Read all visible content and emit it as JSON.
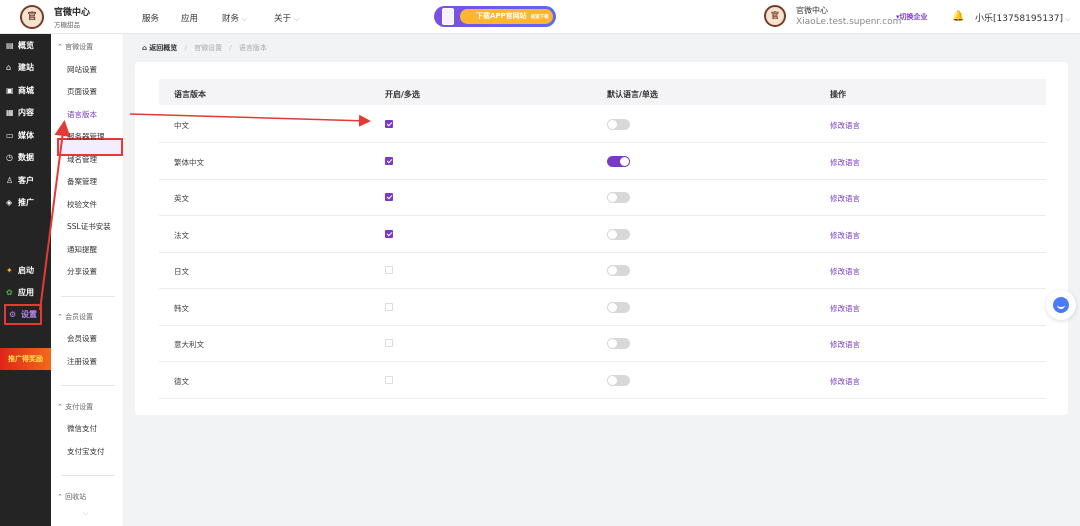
{
  "brand": {
    "logo_text": "官",
    "title": "官微中心",
    "subtitle": "方糖甜品"
  },
  "topnav": {
    "items": [
      "服务",
      "应用",
      "财务",
      "关于"
    ]
  },
  "banner": {
    "text": "下载APP官网站",
    "small": "极速下载"
  },
  "org": {
    "logo_text": "官",
    "name": "官微中心",
    "domain": "XiaoLe.test.supenr.com",
    "switch_label": "切换企业"
  },
  "user": {
    "name": "小乐[13758195137]"
  },
  "sidebar": {
    "items": [
      {
        "icon": "overview-icon",
        "glyph": "▤",
        "label": "概览"
      },
      {
        "icon": "build-icon",
        "glyph": "⌂",
        "label": "建站"
      },
      {
        "icon": "shop-icon",
        "glyph": "▣",
        "label": "商城"
      },
      {
        "icon": "content-icon",
        "glyph": "▦",
        "label": "内容"
      },
      {
        "icon": "media-icon",
        "glyph": "▭",
        "label": "媒体"
      },
      {
        "icon": "data-icon",
        "glyph": "◷",
        "label": "数据"
      },
      {
        "icon": "customer-icon",
        "glyph": "♙",
        "label": "客户"
      },
      {
        "icon": "promote-icon",
        "glyph": "◈",
        "label": "推广"
      }
    ],
    "bottom": [
      {
        "icon": "launch-icon",
        "glyph": "✦",
        "label": "启动"
      },
      {
        "icon": "apps-icon",
        "glyph": "✿",
        "label": "应用"
      },
      {
        "icon": "settings-icon",
        "glyph": "⚙",
        "label": "设置"
      }
    ],
    "promo": "推广得奖励"
  },
  "subnav": {
    "group1": {
      "title": "官微设置",
      "items": [
        "网站设置",
        "页面设置",
        "语言版本",
        "服务器管理",
        "域名管理",
        "备案管理",
        "校验文件",
        "SSL证书安装",
        "通知提醒",
        "分享设置"
      ]
    },
    "group2": {
      "title": "会员设置",
      "items": [
        "会员设置",
        "注册设置"
      ]
    },
    "group3": {
      "title": "支付设置",
      "items": [
        "微信支付",
        "支付宝支付"
      ]
    },
    "group4": {
      "title": "回收站"
    }
  },
  "breadcrumb": {
    "home": "返回概览",
    "items": [
      "官微设置",
      "语言版本"
    ]
  },
  "table": {
    "headers": [
      "语言版本",
      "开启/多选",
      "默认语言/单选",
      "操作"
    ],
    "rows": [
      {
        "lang": "中文",
        "enabled": true,
        "default": false,
        "action": "修改语言"
      },
      {
        "lang": "繁体中文",
        "enabled": true,
        "default": true,
        "action": "修改语言"
      },
      {
        "lang": "英文",
        "enabled": true,
        "default": false,
        "action": "修改语言"
      },
      {
        "lang": "法文",
        "enabled": true,
        "default": false,
        "action": "修改语言"
      },
      {
        "lang": "日文",
        "enabled": false,
        "default": false,
        "action": "修改语言"
      },
      {
        "lang": "韩文",
        "enabled": false,
        "default": false,
        "action": "修改语言"
      },
      {
        "lang": "意大利文",
        "enabled": false,
        "default": false,
        "action": "修改语言"
      },
      {
        "lang": "德文",
        "enabled": false,
        "default": false,
        "action": "修改语言"
      }
    ]
  },
  "colors": {
    "accent": "#7a3ac9",
    "highlight": "#e53935",
    "sidebar": "#242424",
    "banner_pill": "#ffb52e"
  }
}
